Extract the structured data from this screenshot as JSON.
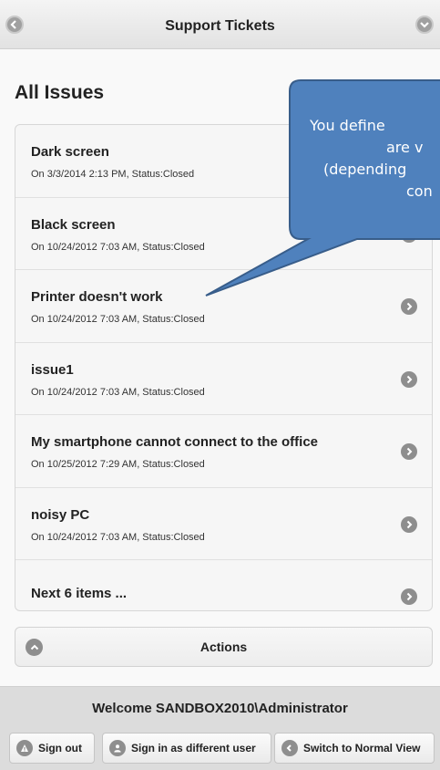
{
  "header": {
    "title": "Support Tickets",
    "back_icon": "back-arrow-icon",
    "home_icon": "forward-arrow-icon"
  },
  "list": {
    "title": "All Issues",
    "items": [
      {
        "title": "Dark screen",
        "subtitle": "On 3/3/2014 2:13 PM, Status:Closed"
      },
      {
        "title": "Black screen",
        "subtitle": "On 10/24/2012 7:03 AM, Status:Closed"
      },
      {
        "title": "Printer doesn't work",
        "subtitle": "On 10/24/2012 7:03 AM, Status:Closed"
      },
      {
        "title": "issue1",
        "subtitle": "On 10/24/2012 7:03 AM, Status:Closed"
      },
      {
        "title": "My smartphone cannot connect to the office",
        "subtitle": "On 10/25/2012 7:29 AM, Status:Closed"
      },
      {
        "title": "noisy PC",
        "subtitle": "On 10/24/2012 7:03 AM, Status:Closed"
      }
    ],
    "next_label": "Next 6 items ..."
  },
  "actions": {
    "label": "Actions"
  },
  "footer": {
    "welcome": "Welcome SANDBOX2010\\Administrator",
    "sign_out": "Sign out",
    "sign_in_different": "Sign in as different user",
    "switch_view": "Switch to Normal View"
  },
  "callout": {
    "line1": "You define",
    "line2": "are v",
    "line3": "(depending",
    "line4": "con",
    "color": "#4f81bd"
  },
  "colors": {
    "icon_gray": "#8e8e8e",
    "callout_fill": "#4f81bd",
    "callout_border": "#385d8a"
  }
}
